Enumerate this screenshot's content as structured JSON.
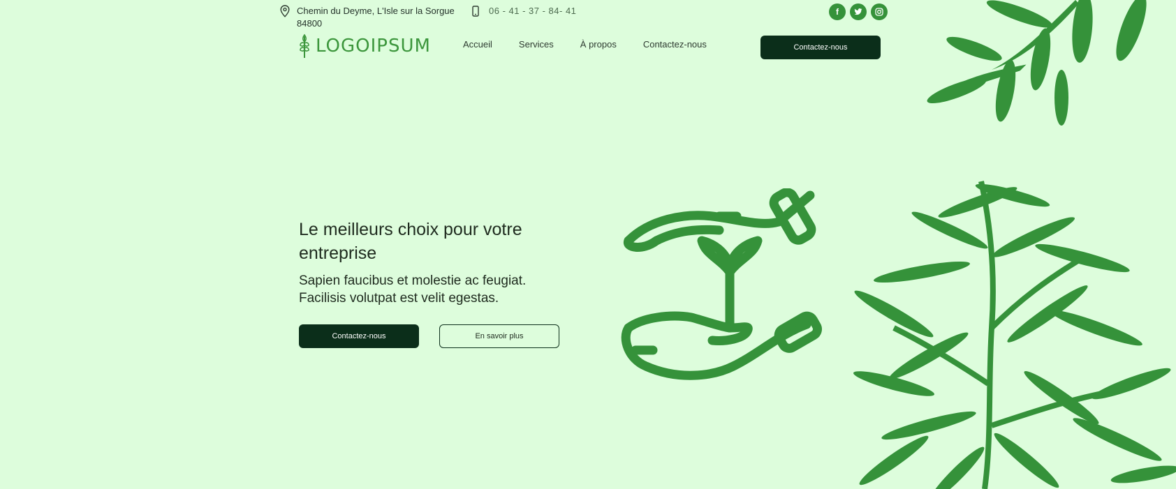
{
  "topbar": {
    "address_line1": "Chemin du Deyme, L'Isle sur la Sorgue",
    "address_line2": "84800",
    "phone": "06 - 41 - 37 - 84- 41",
    "socials": [
      {
        "icon": "facebook-icon",
        "glyph": "f"
      },
      {
        "icon": "twitter-icon",
        "glyph": "t"
      },
      {
        "icon": "instagram-icon",
        "glyph": "◎"
      }
    ]
  },
  "header": {
    "logo_text": "LOGOIPSUM",
    "nav": [
      "Accueil",
      "Services",
      "À propos",
      "Contactez-nous"
    ],
    "cta_label": "Contactez-nous"
  },
  "hero": {
    "title": "Le meilleurs choix pour votre entreprise",
    "subtitle_line1": "Sapien faucibus et molestie ac feugiat.",
    "subtitle_line2": "Facilisis volutpat est velit egestas.",
    "primary_button": "Contactez-nous",
    "secondary_button": "En savoir plus"
  },
  "colors": {
    "background": "#ddfddc",
    "accent_green": "#35923a",
    "dark_button": "#0b2e1a"
  }
}
